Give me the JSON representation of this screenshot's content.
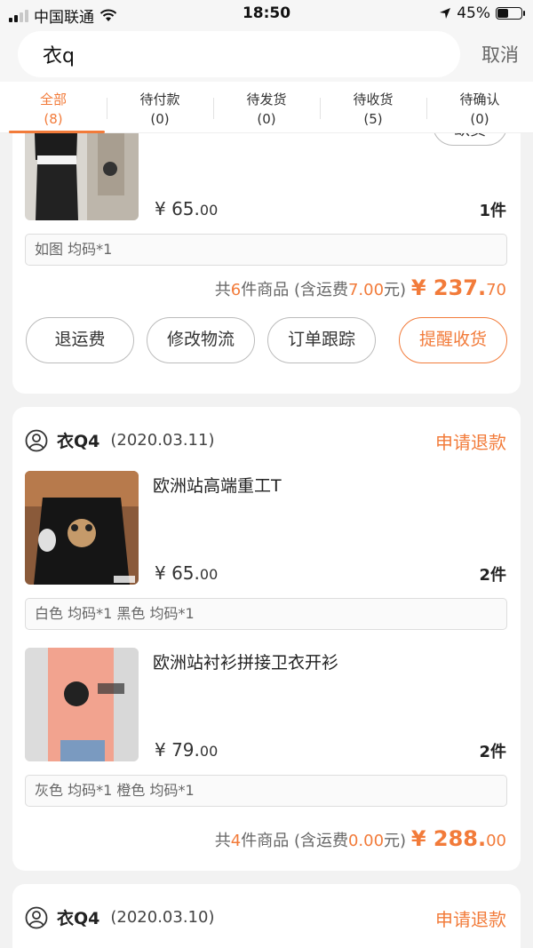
{
  "status": {
    "carrier": "中国联通",
    "time": "18:50",
    "battery": "45%",
    "battery_level": 0.45
  },
  "search": {
    "query": "衣q",
    "cancel_label": "取消"
  },
  "tabs": [
    {
      "label": "全部",
      "count": "(8)",
      "active": true
    },
    {
      "label": "待付款",
      "count": "(0)"
    },
    {
      "label": "待发货",
      "count": "(0)"
    },
    {
      "label": "待收货",
      "count": "(5)"
    },
    {
      "label": "待确认",
      "count": "(0)"
    }
  ],
  "colors": {
    "accent": "#f27b3a"
  },
  "order1": {
    "top_pill_label": "缺货",
    "item": {
      "price_int": "¥ 65.",
      "price_dec": "00",
      "qty": "1件",
      "spec": "如图 均码*1"
    },
    "summary": {
      "pre": "共",
      "count": "6",
      "mid": "件商品 (含运费",
      "shipping": "7.00",
      "post": "元)",
      "total_int": "¥ 237.",
      "total_dec": "70"
    },
    "buttons": [
      "退运费",
      "修改物流",
      "订单跟踪",
      "提醒收货"
    ]
  },
  "order2": {
    "shop": "衣Q4",
    "date": "(2020.03.11)",
    "action": "申请退款",
    "items": [
      {
        "name": "欧洲站高端重工T",
        "price_int": "¥ 65.",
        "price_dec": "00",
        "qty": "2件",
        "spec": "白色 均码*1 黑色 均码*1"
      },
      {
        "name": "欧洲站衬衫拼接卫衣开衫",
        "price_int": "¥ 79.",
        "price_dec": "00",
        "qty": "2件",
        "spec": "灰色 均码*1 橙色 均码*1"
      }
    ],
    "summary": {
      "pre": "共",
      "count": "4",
      "mid": "件商品 (含运费",
      "shipping": "0.00",
      "post": "元)",
      "total_int": "¥ 288.",
      "total_dec": "00"
    }
  },
  "order3": {
    "shop": "衣Q4",
    "date": "(2020.03.10)",
    "action": "申请退款"
  }
}
